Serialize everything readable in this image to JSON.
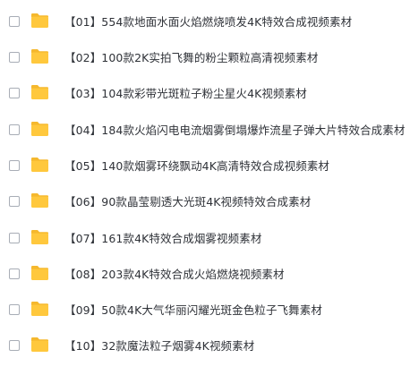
{
  "file_list": {
    "items": [
      {
        "name": "【01】554款地面水面火焰燃烧喷发4K特效合成视频素材",
        "icon": "folder-icon",
        "checked": false
      },
      {
        "name": "【02】100款2K实拍飞舞的粉尘颗粒高清视频素材",
        "icon": "folder-icon",
        "checked": false
      },
      {
        "name": "【03】104款彩带光斑粒子粉尘星火4K视频素材",
        "icon": "folder-icon",
        "checked": false
      },
      {
        "name": "【04】184款火焰闪电电流烟雾倒塌爆炸流星子弹大片特效合成素材",
        "icon": "folder-icon",
        "checked": false
      },
      {
        "name": "【05】140款烟雾环绕飘动4K高清特效合成视频素材",
        "icon": "folder-icon",
        "checked": false
      },
      {
        "name": "【06】90款晶莹剔透大光斑4K视频特效合成素材",
        "icon": "folder-icon",
        "checked": false
      },
      {
        "name": "【07】161款4K特效合成烟雾视频素材",
        "icon": "folder-icon",
        "checked": false
      },
      {
        "name": "【08】203款4K特效合成火焰燃烧视频素材",
        "icon": "folder-icon",
        "checked": false
      },
      {
        "name": "【09】50款4K大气华丽闪耀光斑金色粒子飞舞素材",
        "icon": "folder-icon",
        "checked": false
      },
      {
        "name": "【10】32款魔法粒子烟雾4K视频素材",
        "icon": "folder-icon",
        "checked": false
      }
    ]
  },
  "colors": {
    "folder_body": "#ffc83d",
    "folder_tab": "#f5b82e",
    "text": "#2f3238",
    "checkbox_border": "#a8adb6"
  }
}
